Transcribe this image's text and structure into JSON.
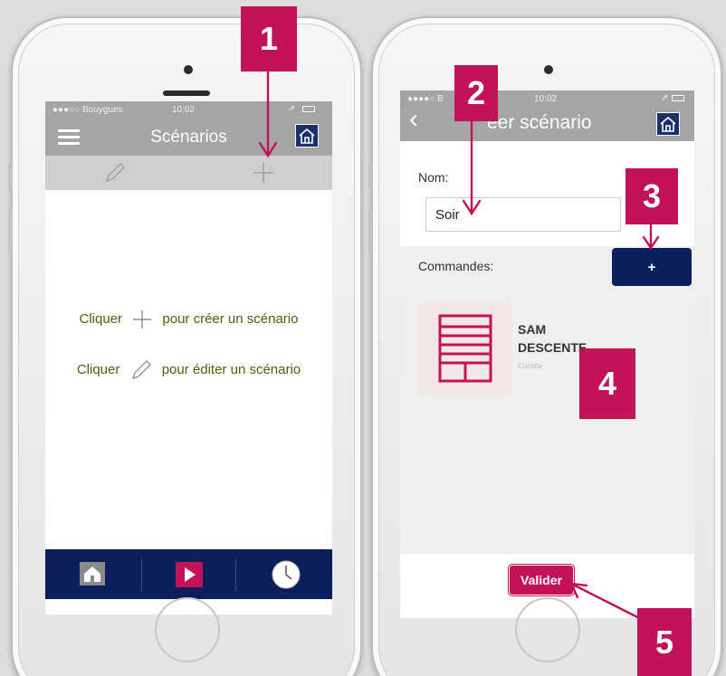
{
  "left_screen": {
    "status": {
      "carrier": "●●●○○ Bouygues",
      "time": "10:02"
    },
    "title": "Scénarios",
    "empty_state": {
      "create_before": "Cliquer",
      "create_after": "pour créer un scénario",
      "edit_before": "Cliquer",
      "edit_after": "pour éditer un scénario"
    },
    "tabbar": {
      "items": [
        "home",
        "scenarios",
        "clock"
      ]
    }
  },
  "right_screen": {
    "status": {
      "carrier": "●●●●○ B",
      "time": "10:02"
    },
    "title": "éer scénario",
    "name_label": "Nom:",
    "name_value": "Soir",
    "commands_label": "Commandes:",
    "add_button": "+",
    "command_card": {
      "line1": "SAM",
      "line2": "DESCENTE",
      "subtitle": "Cocotte"
    },
    "validate_button": "Valider"
  },
  "callouts": [
    "1",
    "2",
    "3",
    "4",
    "5"
  ],
  "colors": {
    "navy": "#0c1e5b",
    "accent": "#c1125a",
    "bar_gray": "#a5a5a5",
    "background": "#dddddd"
  }
}
